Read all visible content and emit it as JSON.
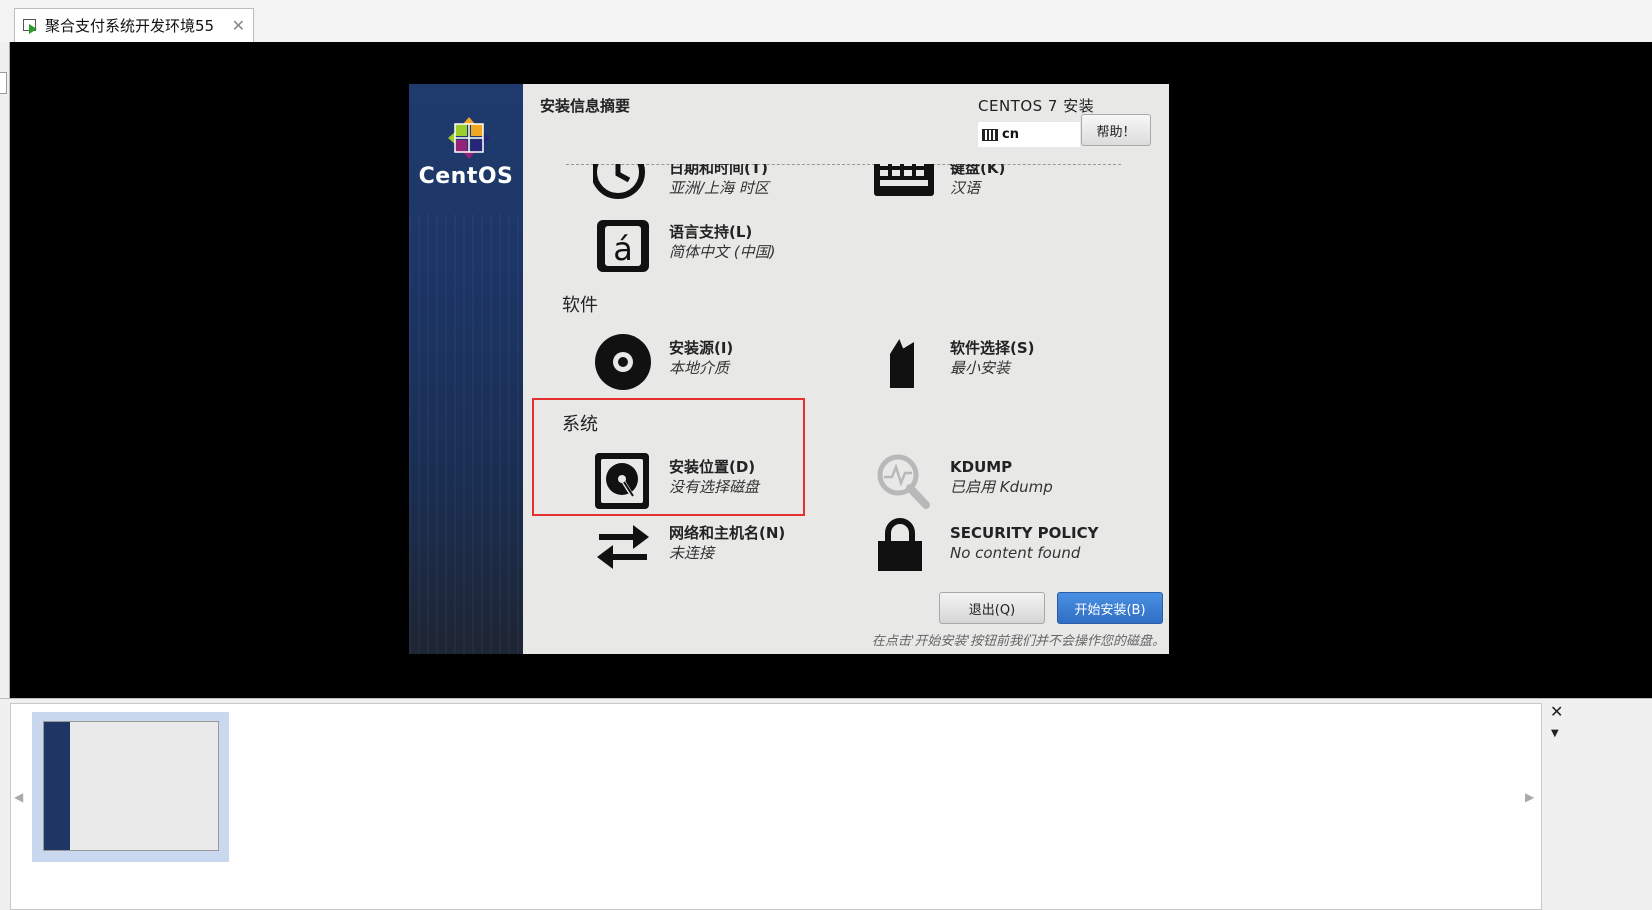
{
  "tab": {
    "title": "聚合支付系统开发环境55",
    "close": "✕"
  },
  "installer": {
    "logo_text": "CentOS",
    "header_title": "安装信息摘要",
    "product_title": "CENTOS 7 安装",
    "keyboard_layout": "cn",
    "help_label": "帮助！",
    "spokes": {
      "datetime": {
        "title": "日期和时间(T)",
        "status": "亚洲/上海 时区"
      },
      "keyboard": {
        "title": "键盘(K)",
        "status": "汉语"
      },
      "language": {
        "title": "语言支持(L)",
        "status": "简体中文 (中国)"
      },
      "source": {
        "title": "安装源(I)",
        "status": "本地介质"
      },
      "software": {
        "title": "软件选择(S)",
        "status": "最小安装"
      },
      "destination": {
        "title": "安装位置(D)",
        "status": "没有选择磁盘"
      },
      "kdump": {
        "title": "KDUMP",
        "status": "已启用 Kdump"
      },
      "network": {
        "title": "网络和主机名(N)",
        "status": "未连接"
      },
      "security": {
        "title": "SECURITY POLICY",
        "status": "No content found"
      }
    },
    "sections": {
      "software": "软件",
      "system": "系统"
    },
    "quit_label": "退出(Q)",
    "begin_label": "开始安装(B)",
    "note": "在点击'开始安装'按钮前我们并不会操作您的磁盘。",
    "highlight_color": "#e53030",
    "begin_color": "#3a7fd5"
  },
  "bottom": {
    "arrow_left": "◀",
    "arrow_right": "▶",
    "close": "✕",
    "dropdown": "▼"
  }
}
